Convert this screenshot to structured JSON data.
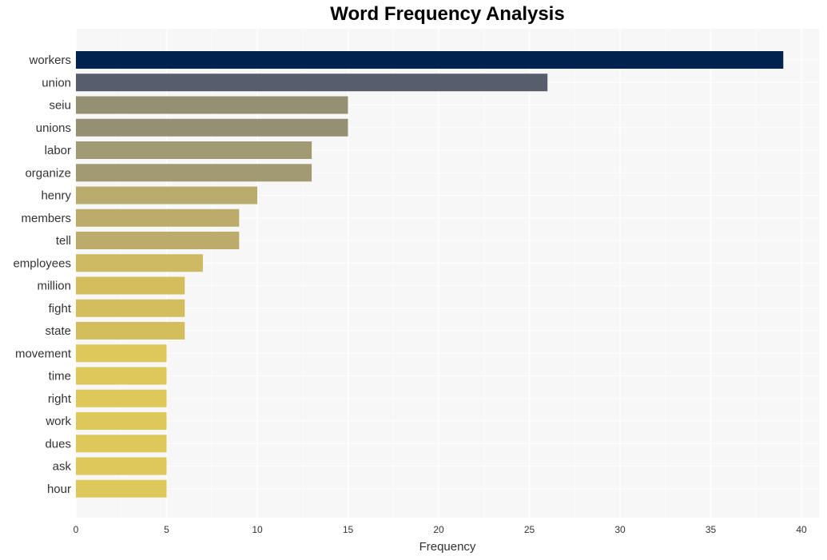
{
  "chart_data": {
    "type": "bar",
    "orientation": "horizontal",
    "title": "Word Frequency Analysis",
    "xlabel": "Frequency",
    "ylabel": "",
    "xlim": [
      0,
      41
    ],
    "xticks": [
      0,
      5,
      10,
      15,
      20,
      25,
      30,
      35,
      40
    ],
    "grid": true,
    "categories": [
      "workers",
      "union",
      "seiu",
      "unions",
      "labor",
      "organize",
      "henry",
      "members",
      "tell",
      "employees",
      "million",
      "fight",
      "state",
      "movement",
      "time",
      "right",
      "work",
      "dues",
      "ask",
      "hour"
    ],
    "values": [
      39,
      26,
      15,
      15,
      13,
      13,
      10,
      9,
      9,
      7,
      6,
      6,
      6,
      5,
      5,
      5,
      5,
      5,
      5,
      5
    ],
    "colors": [
      "#00224e",
      "#575d6d",
      "#958f73",
      "#958f73",
      "#a29a72",
      "#a29a72",
      "#b9ab6c",
      "#bbac6b",
      "#bbac6b",
      "#cdba62",
      "#d4bd5d",
      "#d4bd5d",
      "#d4bd5d",
      "#dec85a",
      "#dec85a",
      "#dec85a",
      "#dec85a",
      "#dec85a",
      "#dec85a",
      "#dec85a"
    ]
  }
}
